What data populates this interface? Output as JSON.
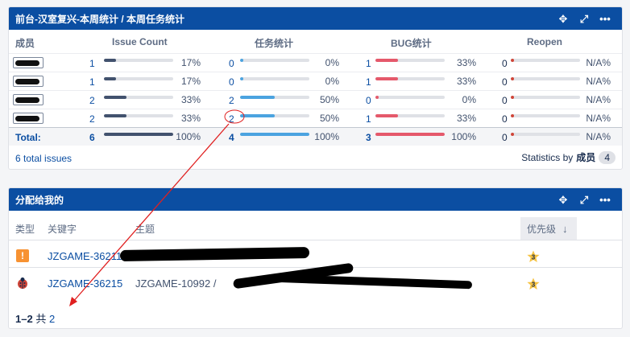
{
  "stats_gadget": {
    "title": "前台-汉室复兴-本周统计 / 本周任务统计",
    "columns": [
      "成员",
      "Issue Count",
      "任务统计",
      "BUG统计",
      "Reopen"
    ],
    "rows": [
      {
        "issue_count": "1",
        "issue_pct": "17%",
        "issue_frac": 0.17,
        "task": "0",
        "task_pct": "0%",
        "task_frac": 0,
        "bug": "1",
        "bug_pct": "33%",
        "bug_frac": 0.33,
        "reopen": "0",
        "reopen_pct": "N/A%"
      },
      {
        "issue_count": "1",
        "issue_pct": "17%",
        "issue_frac": 0.17,
        "task": "0",
        "task_pct": "0%",
        "task_frac": 0,
        "bug": "1",
        "bug_pct": "33%",
        "bug_frac": 0.33,
        "reopen": "0",
        "reopen_pct": "N/A%"
      },
      {
        "issue_count": "2",
        "issue_pct": "33%",
        "issue_frac": 0.33,
        "task": "2",
        "task_pct": "50%",
        "task_frac": 0.5,
        "bug": "0",
        "bug_pct": "0%",
        "bug_frac": 0,
        "reopen": "0",
        "reopen_pct": "N/A%"
      },
      {
        "issue_count": "2",
        "issue_pct": "33%",
        "issue_frac": 0.33,
        "task": "2",
        "task_pct": "50%",
        "task_frac": 0.5,
        "bug": "1",
        "bug_pct": "33%",
        "bug_frac": 0.33,
        "reopen": "0",
        "reopen_pct": "N/A%"
      }
    ],
    "total": {
      "label": "Total:",
      "issue_count": "6",
      "issue_pct": "100%",
      "task": "4",
      "task_pct": "100%",
      "bug": "3",
      "bug_pct": "100%",
      "reopen": "0",
      "reopen_pct": "N/A%"
    },
    "footer_issues": "6 total issues",
    "footer_stats_prefix": "Statistics by",
    "footer_stats_field": "成员",
    "footer_stats_count": "4"
  },
  "assigned_gadget": {
    "title": "分配给我的",
    "columns": {
      "type": "类型",
      "key": "关键字",
      "summary": "主题",
      "priority": "优先级"
    },
    "rows": [
      {
        "type_icon": "task-icon",
        "key": "JZGAME-36211",
        "summary_prefix": "",
        "priority": "3"
      },
      {
        "type_icon": "bug-icon",
        "key": "JZGAME-36215",
        "summary_prefix": "JZGAME-10992 /",
        "priority": "3"
      }
    ],
    "pager_range": "1–2",
    "pager_of": "共",
    "pager_total": "2"
  },
  "colors": {
    "header": "#0b4ea2",
    "issue_bar": "#42526e",
    "task_bar": "#4ba3e0",
    "bug_bar": "#e5596b",
    "reopen_dot": "#d04437",
    "annotation": "#e02020"
  }
}
